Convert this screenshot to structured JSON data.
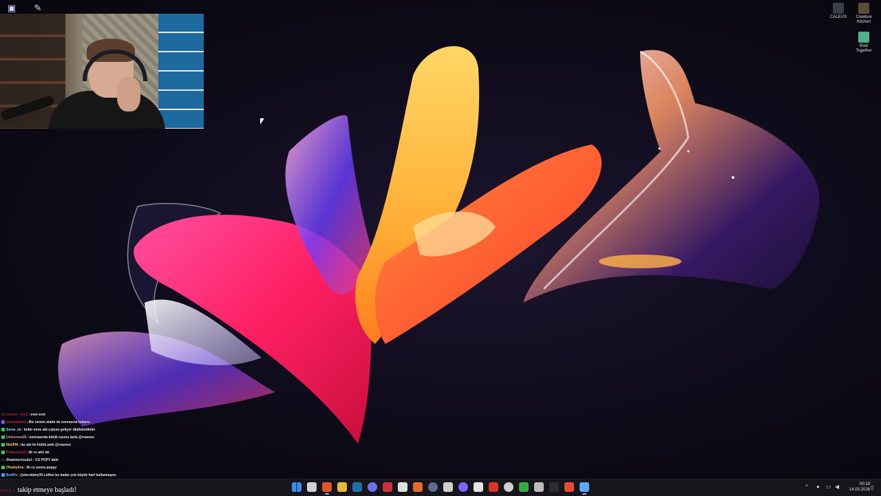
{
  "desktop": {
    "icons": [
      {
        "name": "caleus-shortcut",
        "label": "CALEUS",
        "color": "#3a3f46"
      },
      {
        "name": "creature-kitchen-shortcut",
        "label": "Creature\nKitchen",
        "color": "#5b4d3e"
      },
      {
        "name": "boat-together-shortcut",
        "label": "Boat\nTogether",
        "color": "#4fb28a"
      }
    ]
  },
  "chat": {
    "messages": [
      {
        "user": "aylasm_sdn2",
        "text": ": evet evet",
        "user_color": "#b02038",
        "badge_color": "#2a1f26"
      },
      {
        "user": "overporta10",
        "text": ": Biz cemizi ataim de sonrasına bakarız",
        "user_color": "#d0243b",
        "badge_color": "#7a5cff"
      },
      {
        "user": "Sema_ek",
        "text": ": küfür etme abi uykum geliyor dkdkdmdkdm",
        "user_color": "#9fd3ff",
        "badge_color": "#2bd167"
      },
      {
        "user": "Universee26",
        "text": ": sonrasında kütük oyunu lazla @rraenee",
        "user_color": "#ff9bd0",
        "badge_color": "#2bd167"
      },
      {
        "user": "MaliPM",
        "text": ": laz abi ile kütük peki @rraenee",
        "user_color": "#ffcc66",
        "badge_color": "#2bd167"
      },
      {
        "user": "Pobocent12",
        "text": ": ilk cs atin ab",
        "user_color": "#c2304a",
        "badge_color": "#2bd167"
      },
      {
        "user": "Shadowclouds1",
        "text": ": CS POPY abin",
        "user_color": "#e8e8e8",
        "badge_color": "#1f1f26"
      },
      {
        "user": "Ohwhylina",
        "text": ": ilk cs sonra poppy",
        "user_color": "#ffd27a",
        "badge_color": "#2bd167"
      },
      {
        "user": "BotRix",
        "text": ": @dorukbey39 Lütfen bu kadar çok büyük harf kullanmayın.",
        "user_color": "#7fbfff",
        "badge_color": "#3aa0ff"
      }
    ]
  },
  "follow_alert": {
    "name": "ElsSol_1",
    "text": "takip etmeye başladı!"
  },
  "taskbar": {
    "apps": [
      {
        "name": "start-button",
        "color": "#3b8fea"
      },
      {
        "name": "search-icon",
        "color": "#d0d0d0"
      },
      {
        "name": "brave-browser-icon",
        "color": "#e2552a"
      },
      {
        "name": "file-explorer-icon",
        "color": "#e8b83a"
      },
      {
        "name": "steam-icon",
        "color": "#1f6fa8"
      },
      {
        "name": "discord-icon",
        "color": "#6a6ff0"
      },
      {
        "name": "media-app-icon",
        "color": "#c8323a"
      },
      {
        "name": "capcut-icon",
        "color": "#e0e0e0"
      },
      {
        "name": "autodesk-icon",
        "color": "#e26b2a"
      },
      {
        "name": "app-circle-icon",
        "color": "#5c6b8e"
      },
      {
        "name": "chatgpt-icon",
        "color": "#cfcfcf"
      },
      {
        "name": "obs-studio-icon",
        "color": "#7766ff"
      },
      {
        "name": "feather-icon",
        "color": "#e4e4e4"
      },
      {
        "name": "adobe-acrobat-icon",
        "color": "#d9342b"
      },
      {
        "name": "settings-gear-icon",
        "color": "#cfcfcf"
      },
      {
        "name": "minecraft-icon",
        "color": "#3aa845"
      },
      {
        "name": "tool-icon",
        "color": "#bdbdbd"
      },
      {
        "name": "app-dark-icon",
        "color": "#2b2b33"
      },
      {
        "name": "pen-icon",
        "color": "#ea4b36"
      },
      {
        "name": "vpn-icon",
        "color": "#5aa8ff"
      }
    ],
    "time": "00:19",
    "date": "14.03.2026"
  }
}
